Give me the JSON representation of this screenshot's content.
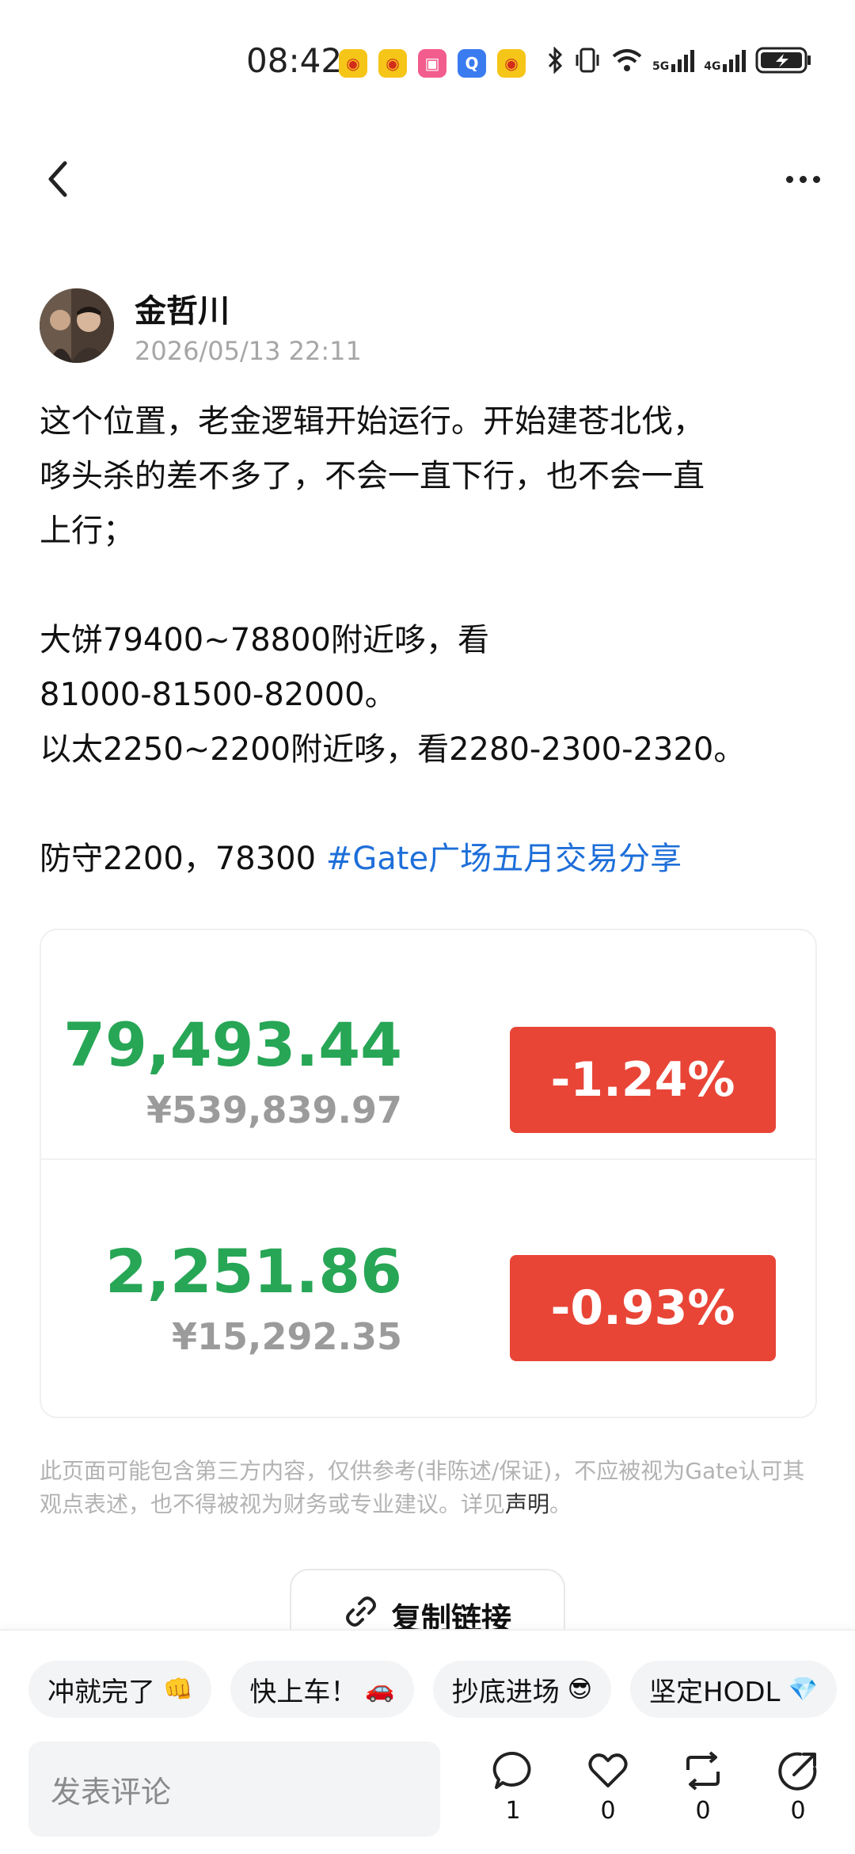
{
  "status_bar": {
    "time": "08:42",
    "network_1": "5G",
    "network_2": "4G"
  },
  "post": {
    "author_name": "金哲川",
    "timestamp": "2026/05/13 22:11",
    "lines": [
      "这个位置，老金逻辑开始运行。开始建苍北伐，",
      "哆头杀的差不多了，不会一直下行，也不会一直",
      "上行；",
      "",
      "大饼79400~78800附近哆，看",
      "81000-81500-82000。",
      "以太2250~2200附近哆，看2280-2300-2320。",
      "",
      "防守2200，78300 "
    ],
    "hashtag": "#Gate广场五月交易分享"
  },
  "tickers": [
    {
      "price": "79,493.44",
      "cny": "¥539,839.97",
      "change": "-1.24%"
    },
    {
      "price": "2,251.86",
      "cny": "¥15,292.35",
      "change": "-0.93%"
    }
  ],
  "disclaimer": {
    "text": "此页面可能包含第三方内容，仅供参考(非陈述/保证)，不应被视为Gate认可其观点表述，也不得被视为财务或专业建议。详见",
    "link": "声明",
    "suffix": "。"
  },
  "copy_link_label": "复制链接",
  "quick_replies": [
    {
      "label": "冲就完了",
      "emoji": "👊"
    },
    {
      "label": "快上车！",
      "emoji": "🚗"
    },
    {
      "label": "抄底进场",
      "emoji": "😎"
    },
    {
      "label": "坚定HODL",
      "emoji": "💎"
    }
  ],
  "comment_placeholder": "发表评论",
  "actions": {
    "comment_count": "1",
    "like_count": "0",
    "repost_count": "0",
    "share_count": "0"
  },
  "colors": {
    "price_green": "#27a656",
    "badge_red": "#e84537",
    "hashtag_blue": "#1e6fd9"
  }
}
